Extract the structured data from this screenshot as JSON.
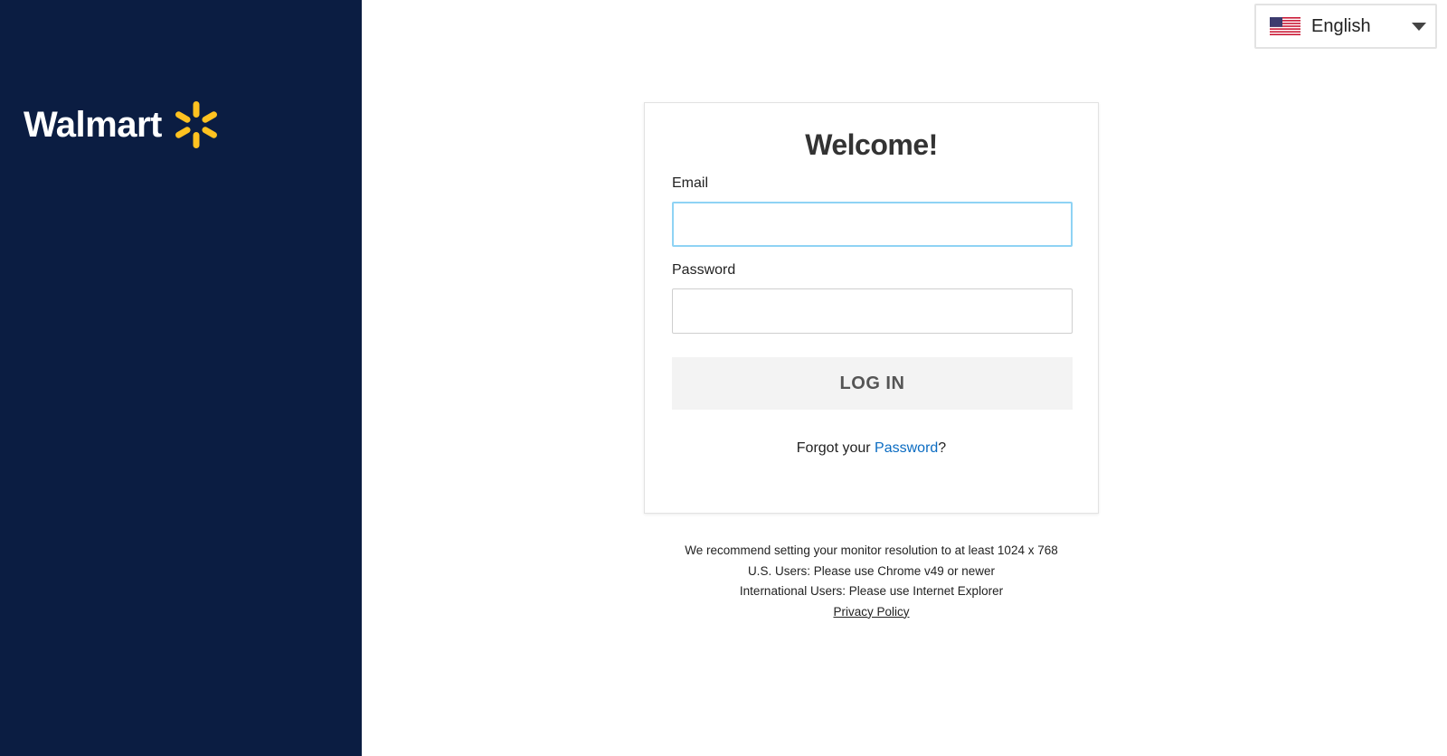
{
  "brand": {
    "logo_text": "Walmart",
    "logo_color": "#ffffff",
    "spark_color": "#ffc220",
    "sidebar_color": "#0b1d42"
  },
  "language": {
    "selected": "English",
    "flag_icon": "us-flag-icon",
    "dropdown_icon": "caret-down-icon"
  },
  "login_card": {
    "title": "Welcome!",
    "email_label": "Email",
    "email_value": "",
    "password_label": "Password",
    "password_value": "",
    "login_button": "LOG IN",
    "forgot_prefix": "Forgot your ",
    "forgot_link": "Password",
    "forgot_suffix": "?"
  },
  "footer_notes": {
    "line1": "We recommend setting your monitor resolution to at least 1024 x 768",
    "line2": "U.S. Users: Please use Chrome v49 or newer",
    "line3": "International Users: Please use Internet Explorer",
    "privacy_link": "Privacy Policy"
  },
  "colors": {
    "link": "#0b6cc2",
    "focus_border": "#8fd3f4",
    "button_bg": "#f3f3f3"
  }
}
